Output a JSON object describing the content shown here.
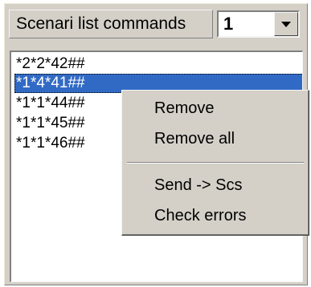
{
  "header": {
    "label": "Scenari list commands",
    "combo_value": "1",
    "combo_icon": "chevron-down-icon"
  },
  "list": {
    "items": [
      {
        "text": "*2*2*42##",
        "selected": false
      },
      {
        "text": "*1*4*41##",
        "selected": true
      },
      {
        "text": "*1*1*44##",
        "selected": false
      },
      {
        "text": "*1*1*45##",
        "selected": false
      },
      {
        "text": "*1*1*46##",
        "selected": false
      }
    ]
  },
  "context_menu": {
    "remove": "Remove",
    "remove_all": "Remove all",
    "send_to_scs": "Send -> Scs",
    "check_errors": "Check errors"
  },
  "colors": {
    "selection": "#316ac5",
    "window_face": "#d4d0c8"
  }
}
